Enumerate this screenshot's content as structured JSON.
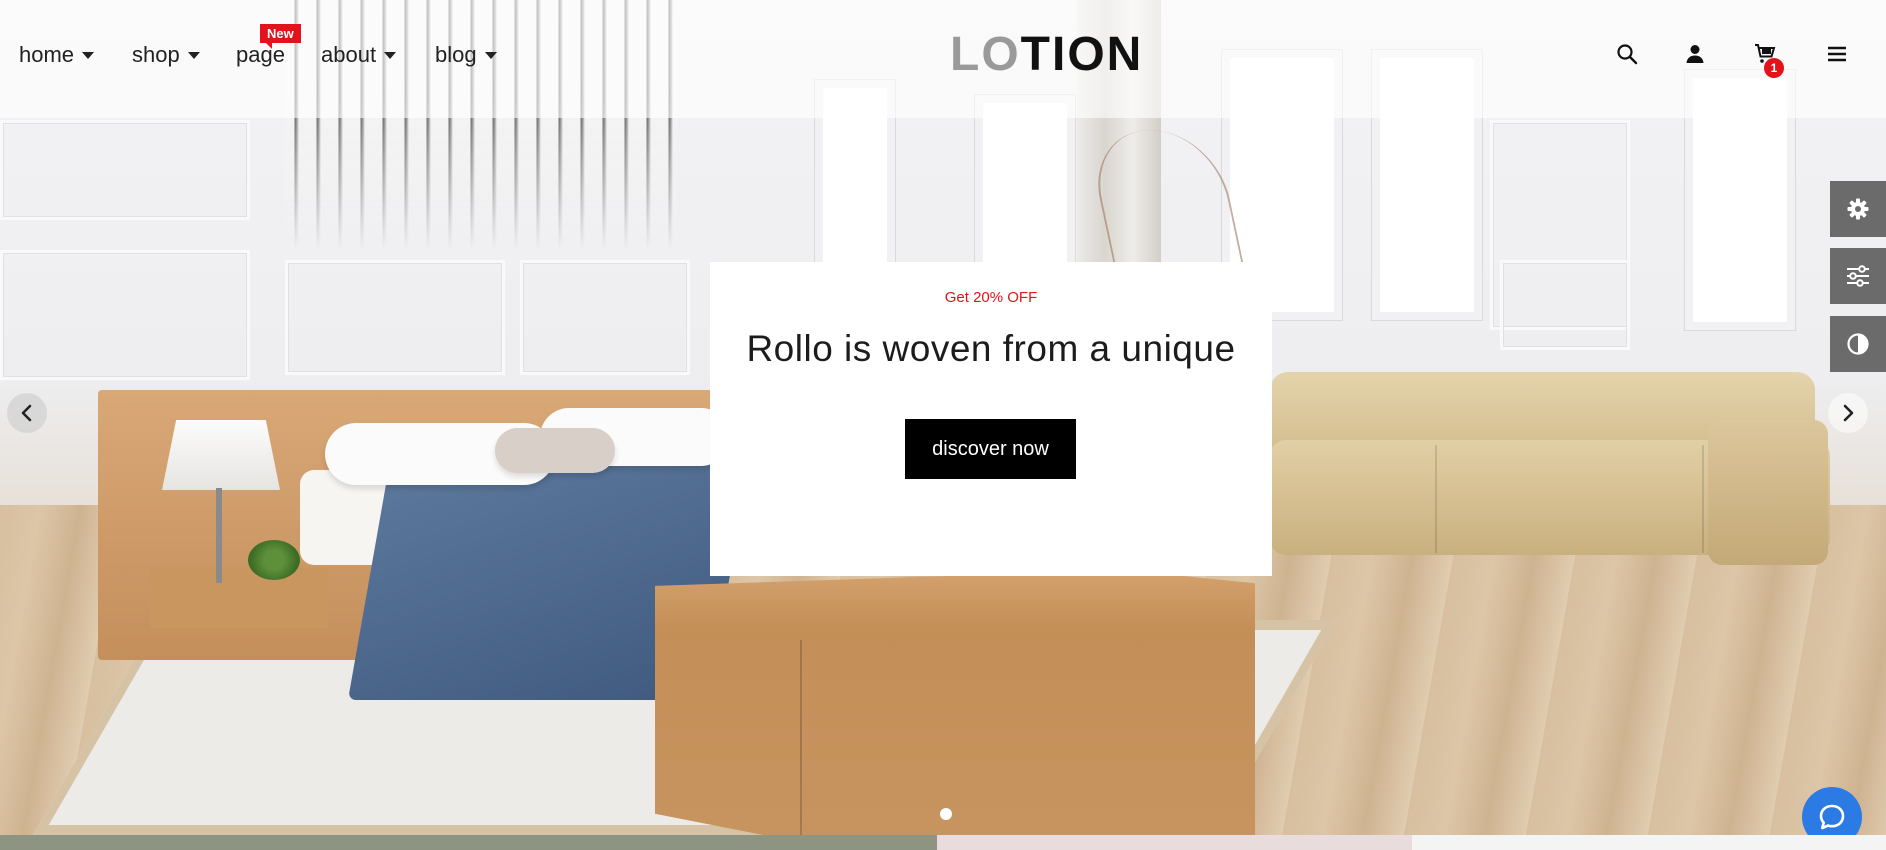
{
  "nav": {
    "items": [
      {
        "label": "home",
        "has_dropdown": true
      },
      {
        "label": "shop",
        "has_dropdown": true
      },
      {
        "label": "page",
        "has_dropdown": false,
        "badge": "New"
      },
      {
        "label": "about",
        "has_dropdown": true
      },
      {
        "label": "blog",
        "has_dropdown": true
      }
    ]
  },
  "logo": {
    "part1": "LO",
    "part2": "TION"
  },
  "header_actions": {
    "icons": [
      "search-icon",
      "user-icon",
      "cart-icon",
      "menu-icon"
    ],
    "cart_count": "1"
  },
  "hero": {
    "tag": "Get 20% OFF",
    "title": "Rollo is woven from a unique",
    "button_label": "discover now"
  },
  "right_rail": {
    "icons": [
      "gear-icon",
      "sliders-icon",
      "contrast-icon"
    ]
  },
  "slider": {
    "arrows": [
      "chevron-left-icon",
      "chevron-right-icon"
    ]
  },
  "chat": {
    "icon": "chat-bubble-icon"
  },
  "colors": {
    "accent_red": "#e4121a",
    "button_black": "#000000",
    "rail_grey": "#6b6b6b",
    "chat_blue": "#2c7be5"
  }
}
